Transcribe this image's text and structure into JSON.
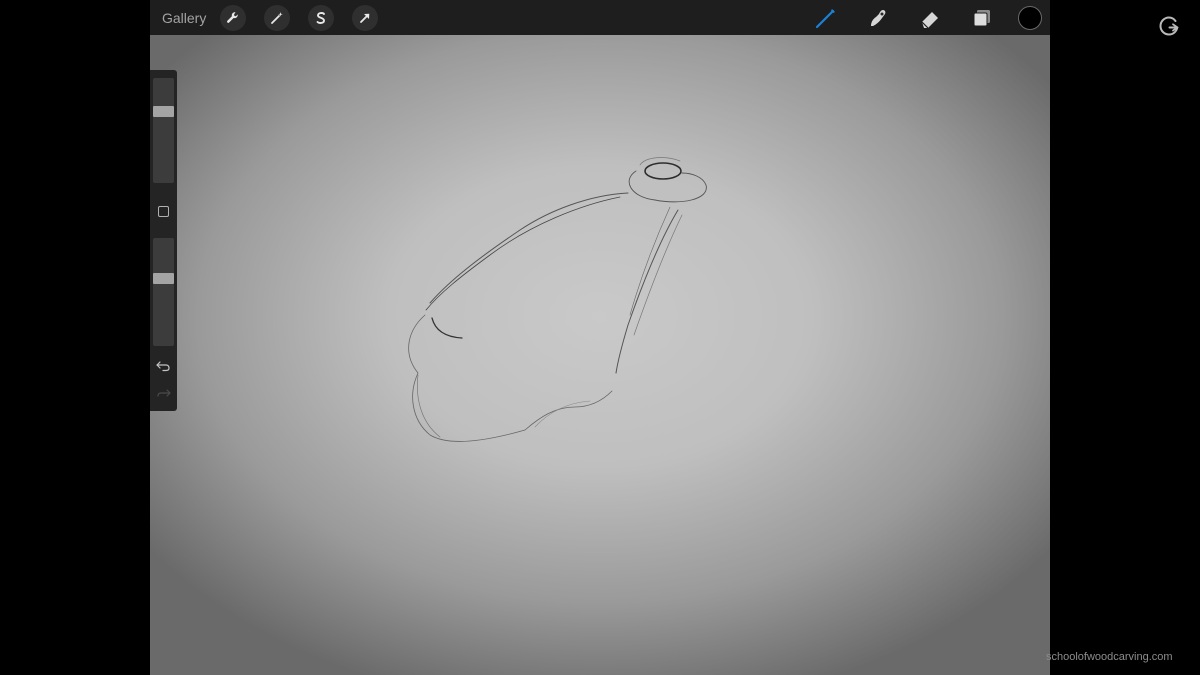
{
  "toolbar": {
    "gallery_label": "Gallery",
    "left_tools": [
      "wrench-icon",
      "magic-wand-icon",
      "selection-s-icon",
      "transform-arrow-icon"
    ],
    "right_tools": [
      "brush-icon",
      "smudge-icon",
      "eraser-icon",
      "layers-icon"
    ],
    "active_tool": "brush",
    "active_tool_color": "#1a82d8",
    "current_color": "#000000"
  },
  "sidebar": {
    "brush_size_level": 0.08,
    "opacity_level": 0.15,
    "modify_button": "square-modify-icon",
    "undo_icon": "undo-arrow-icon",
    "redo_icon": "redo-arrow-icon"
  },
  "canvas": {
    "content": "pencil-sketch"
  },
  "overlay": {
    "logo": "g-arrow-logo",
    "watermark_text": "schoolofwoodcarving.com"
  }
}
